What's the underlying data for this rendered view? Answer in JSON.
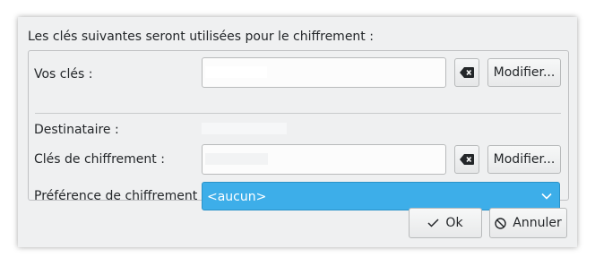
{
  "dialog": {
    "heading": "Les clés suivantes seront utilisées pour le chiffrement :"
  },
  "own_keys": {
    "label": "Vos clés :",
    "value": "",
    "clear_icon": "backspace-clear-icon",
    "modify_label": "Modifier..."
  },
  "recipient": {
    "label": "Destinataire :",
    "value": ""
  },
  "encryption_key": {
    "label": "Clés de chiffrement :",
    "value": "",
    "clear_icon": "backspace-clear-icon",
    "modify_label": "Modifier..."
  },
  "preference": {
    "label": "Préférence de chiffrement :",
    "selected": "<aucun>",
    "arrow_icon": "chevron-down-icon"
  },
  "footer": {
    "ok_label": "Ok",
    "ok_icon": "checkmark-icon",
    "cancel_label": "Annuler",
    "cancel_icon": "cancel-circle-icon"
  },
  "colors": {
    "accent": "#3daee9",
    "window_bg": "#eff0f1",
    "text": "#232629"
  }
}
